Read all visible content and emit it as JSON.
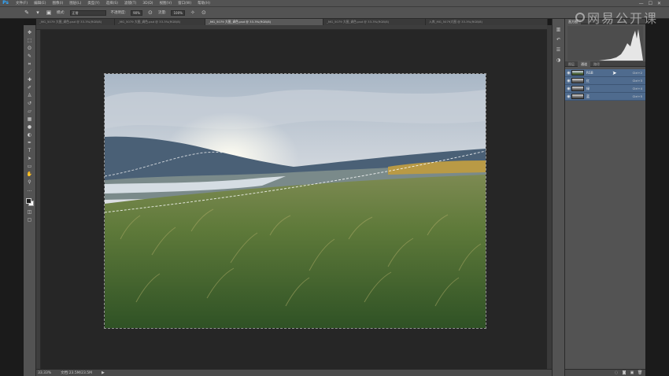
{
  "app": {
    "logo": "Ps",
    "menu": [
      "文件(F)",
      "编辑(E)",
      "图像(I)",
      "图层(L)",
      "类型(Y)",
      "选择(S)",
      "滤镜(T)",
      "3D(D)",
      "视图(V)",
      "窗口(W)",
      "帮助(H)"
    ],
    "window_controls": [
      "—",
      "☐",
      "✕"
    ]
  },
  "watermark": {
    "text": "网易公开课"
  },
  "options": {
    "mode_label": "模式:",
    "mode_value": "正常",
    "opacity_label": "不透明度:",
    "opacity_value": "90%",
    "flow_label": "流量:",
    "flow_value": "100%"
  },
  "tabs": [
    {
      "label": "_MG_5079 大图_调色.psd @ 33.3%(RGB/8)",
      "active": false
    },
    {
      "label": "_MG_5079 大图_调色.psd @ 33.3%(RGB/8)",
      "active": false
    },
    {
      "label": "_MG_5079 大图_调色.psd @ 33.3%(RGB/8)",
      "active": true
    },
    {
      "label": "_MG_5079 大图_调色.psd @ 33.3%(RGB/8)",
      "active": false
    },
    {
      "label": "入库_MG_5079大图 @ 33.3%(RGB/8)",
      "active": false
    }
  ],
  "status": {
    "zoom": "33.33%",
    "doc": "文档:23.5M/23.5M",
    "arrow": "▶"
  },
  "panels": {
    "histogram_tabs": [
      "直方图"
    ],
    "layer_tabs": [
      "图层",
      "通道",
      "路径"
    ],
    "channels": [
      {
        "name": "RGB",
        "key": "Ctrl+2",
        "gray": false
      },
      {
        "name": "红",
        "key": "Ctrl+3",
        "gray": true
      },
      {
        "name": "绿",
        "key": "Ctrl+4",
        "gray": true
      },
      {
        "name": "蓝",
        "key": "Ctrl+5",
        "gray": true
      }
    ]
  },
  "colors": {
    "selected_channel": "#4f6b8e",
    "ui_panel": "#535353"
  }
}
